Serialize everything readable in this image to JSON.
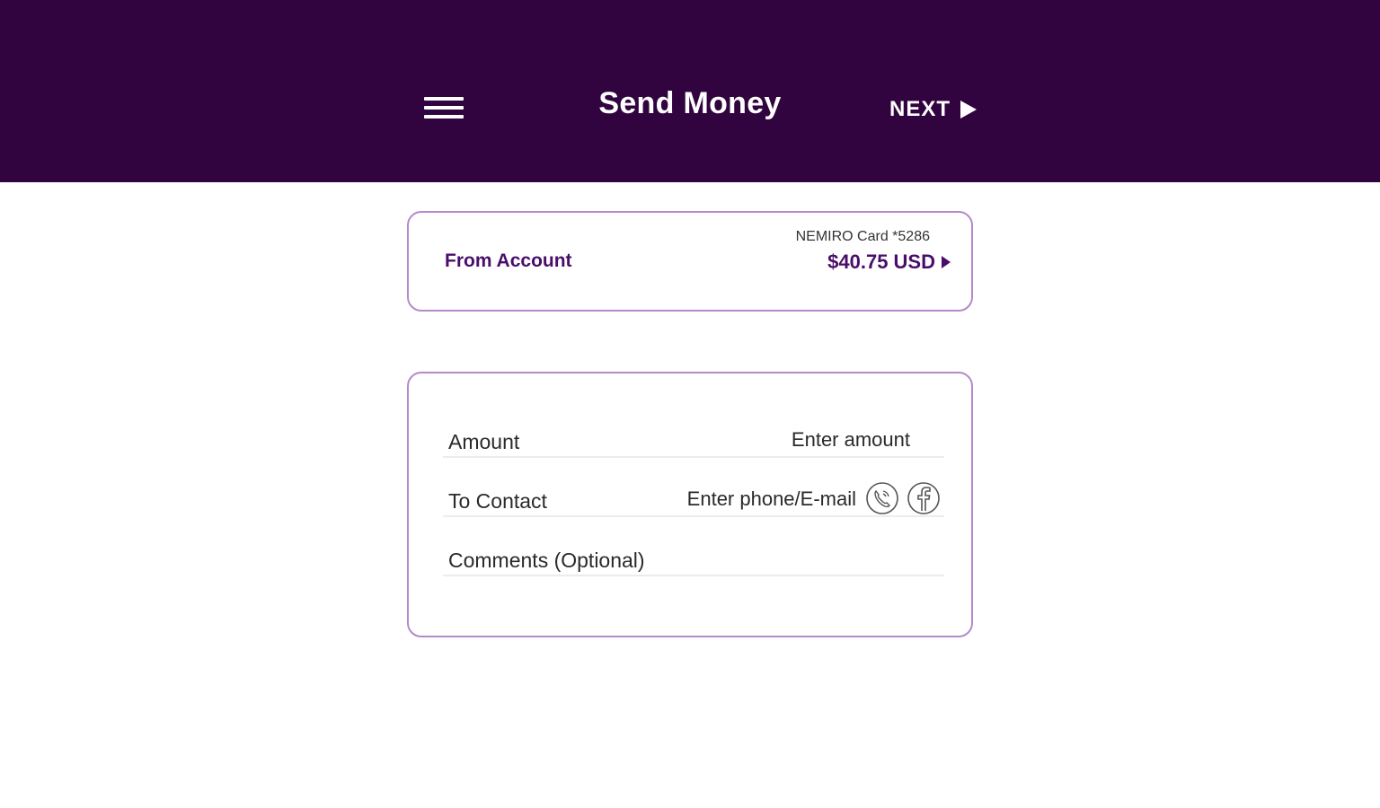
{
  "header": {
    "title": "Send Money",
    "next_label": "NEXT",
    "background": "#32043f",
    "icons": [
      "menu-icon",
      "play-arrow-icon"
    ]
  },
  "from_account": {
    "label": "From Account",
    "card_name": "NEMIRO Card *5286",
    "balance": "$40.75 USD",
    "accent": "#4a0e6a"
  },
  "form": {
    "amount": {
      "label": "Amount",
      "placeholder": "Enter amount"
    },
    "contact": {
      "label": "To Contact",
      "placeholder": "Enter phone/E-mail",
      "icons": [
        "phone-contact-icon",
        "facebook-icon"
      ]
    },
    "comments": {
      "label": "Comments (Optional)",
      "placeholder": ""
    }
  }
}
